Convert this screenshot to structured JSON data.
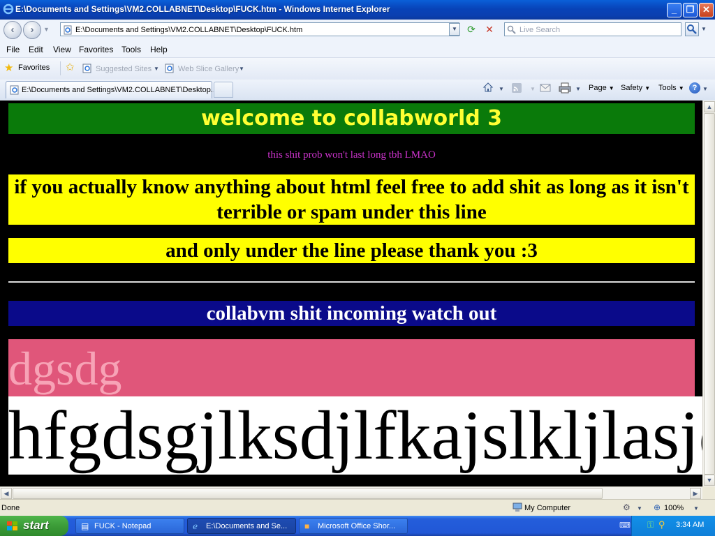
{
  "window": {
    "title": "E:\\Documents and Settings\\VM2.COLLABNET\\Desktop\\FUCK.htm - Windows Internet Explorer",
    "minimize": "_",
    "maximize": "❐",
    "close": "✕"
  },
  "address": {
    "url": "E:\\Documents and Settings\\VM2.COLLABNET\\Desktop\\FUCK.htm",
    "search_placeholder": "Live Search"
  },
  "menu": [
    "File",
    "Edit",
    "View",
    "Favorites",
    "Tools",
    "Help"
  ],
  "favorites_bar": {
    "favorites": "Favorites",
    "suggested_sites": "Suggested Sites",
    "web_slice_gallery": "Web Slice Gallery"
  },
  "tab": {
    "label": "E:\\Documents and Settings\\VM2.COLLABNET\\Desktop..."
  },
  "command_bar": {
    "page": "Page",
    "safety": "Safety",
    "tools": "Tools"
  },
  "page": {
    "heading": "welcome to collabworld 3",
    "subtitle": "this shit prob won't last long tbh LMAO",
    "notice1": "if you actually know anything about html feel free to add shit as long as it isn't terrible or spam under this line",
    "notice2": "and only under the line please thank you :3",
    "banner": "collabvm shit incoming watch out",
    "pink_text": "dgsdg",
    "big_text": "hfgdsgjlksdjlfkajslkljlasjdl"
  },
  "status": {
    "left": "Done",
    "zone": "My Computer",
    "zoom": "100%"
  },
  "taskbar": {
    "start": "start",
    "tasks": [
      "FUCK - Notepad",
      "E:\\Documents and Se...",
      "Microsoft Office Shor..."
    ],
    "clock": "3:34 AM"
  },
  "colors": {
    "heading_bg": "#0a7a0a",
    "heading_fg": "#ffff33",
    "subtitle": "#cc33cc",
    "notice_bg": "#ffff00",
    "banner_bg": "#0a0a8a",
    "pink_bg": "#e0567a",
    "pink_fg": "#f7a3b6"
  }
}
